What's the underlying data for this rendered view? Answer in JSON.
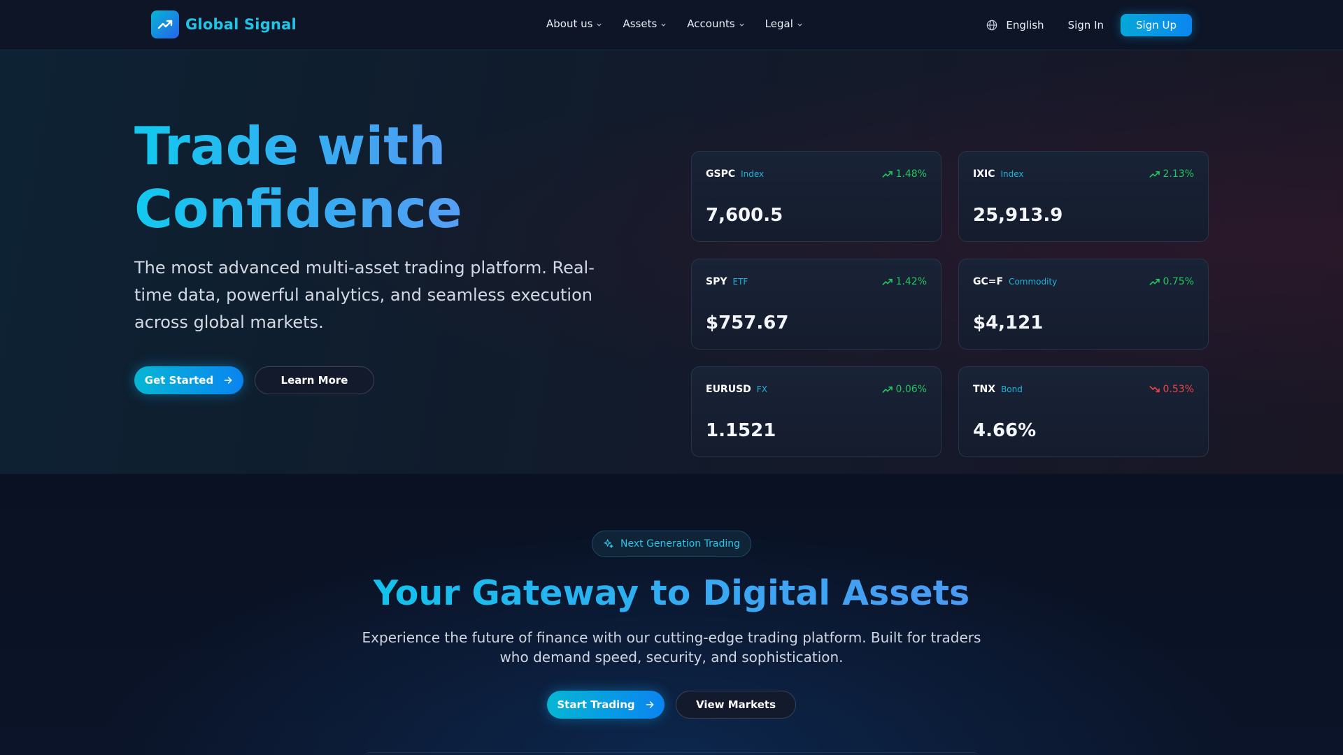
{
  "brand": {
    "name": "Global Signal",
    "logo_icon": "trending-up-icon"
  },
  "nav": {
    "items": [
      {
        "label": "About us"
      },
      {
        "label": "Assets"
      },
      {
        "label": "Accounts"
      },
      {
        "label": "Legal"
      }
    ],
    "language": "English",
    "sign_in": "Sign In",
    "sign_up": "Sign Up"
  },
  "hero": {
    "title_line1": "Trade with",
    "title_line2": "Confidence",
    "subtitle": "The most advanced multi-asset trading platform. Real-time data, powerful analytics, and seamless execution across global markets.",
    "primary_button": "Get Started",
    "secondary_button": "Learn More"
  },
  "tickers": [
    {
      "symbol": "GSPC",
      "type": "Index",
      "change": "1.48%",
      "direction": "up",
      "price": "7,600.5"
    },
    {
      "symbol": "IXIC",
      "type": "Index",
      "change": "2.13%",
      "direction": "up",
      "price": "25,913.9"
    },
    {
      "symbol": "SPY",
      "type": "ETF",
      "change": "1.42%",
      "direction": "up",
      "price": "$757.67"
    },
    {
      "symbol": "GC=F",
      "type": "Commodity",
      "change": "0.75%",
      "direction": "up",
      "price": "$4,121"
    },
    {
      "symbol": "EURUSD",
      "type": "FX",
      "change": "0.06%",
      "direction": "up",
      "price": "1.1521"
    },
    {
      "symbol": "TNX",
      "type": "Bond",
      "change": "0.53%",
      "direction": "down",
      "price": "4.66%"
    }
  ],
  "section2": {
    "badge": "Next Generation Trading",
    "title": "Your Gateway to Digital Assets",
    "subtitle_line1": "Experience the future of finance with our cutting-edge trading platform. Built for traders",
    "subtitle_line2": "who demand speed, security, and sophistication.",
    "primary_button": "Start Trading",
    "secondary_button": "View Markets"
  },
  "colors": {
    "accent": "#06b6d4",
    "accent_blue": "#0a84f0",
    "positive": "#22c55e",
    "negative": "#ef4444",
    "background": "#0b1224"
  }
}
